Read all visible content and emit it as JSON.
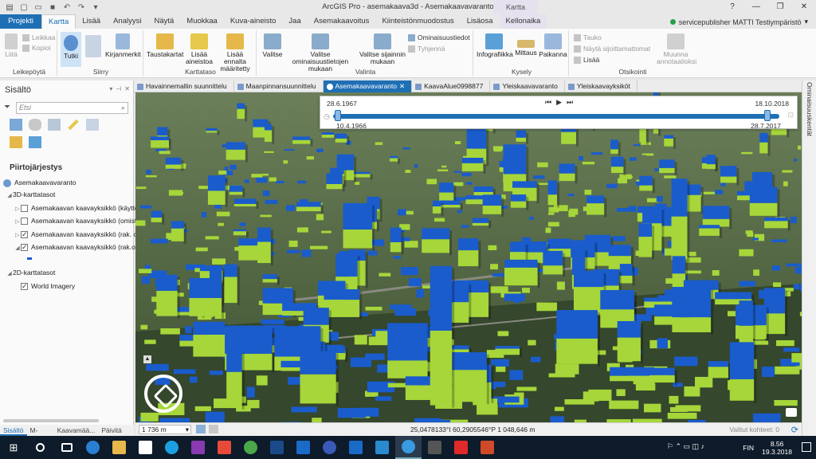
{
  "app": {
    "title": "ArcGIS Pro - asemakaava3d - Asemakaavavaranto",
    "context_header": "Kartta",
    "user": "servicepublisher MATTI Testiympäristö"
  },
  "ribbon_tabs": [
    "Projekti",
    "Kartta",
    "Lisää",
    "Analyysi",
    "Näytä",
    "Muokkaa",
    "Kuva-aineisto",
    "Jaa",
    "Asemakaavoitus",
    "Kiinteistönmuodostus",
    "Lisäosa",
    "Kellonaika"
  ],
  "ribbon": {
    "leikepoyta": {
      "label": "Leikepöytä",
      "liita": "Liitä",
      "leikkaa": "Leikkaa",
      "kopioi": "Kopioi"
    },
    "siirry": {
      "label": "Siirry",
      "tutki": "Tutki",
      "kirjanmerkit": "Kirjanmerkit"
    },
    "karttataso": {
      "label": "Karttataso",
      "taustakartat": "Taustakartat",
      "lisaa_aineistoa": "Lisää aineistoa",
      "lisaa_ennalta": "Lisää ennalta määritetty"
    },
    "valinta": {
      "label": "Valinta",
      "valitse": "Valitse",
      "valitse_ominaisuus": "Valitse ominaisuustietojen mukaan",
      "valitse_sijainti": "Valitse sijainnin mukaan",
      "ominaisuustiedot": "Ominaisuustiedot",
      "tyhjenna": "Tyhjennä"
    },
    "kysely": {
      "label": "Kysely",
      "infografiikka": "Infografiikka",
      "mittaus": "Mittaus",
      "paikanna": "Paikanna"
    },
    "otsikointi": {
      "label": "Otsikointi",
      "tauko": "Tauko",
      "nayta": "Näytä sijoittamattomat",
      "lisaa": "Lisää",
      "muunna": "Muunna annotaatioksi"
    }
  },
  "contents": {
    "title": "Sisältö",
    "search_placeholder": "Etsi",
    "draw_order": "Piirtojärjestys",
    "map_name": "Asemakaavavaranto",
    "group_3d": "3D-karttatasot",
    "layers_3d": [
      {
        "name": "Asemakaavan kaavayksikkö (käyttöt",
        "checked": false
      },
      {
        "name": "Asemakaavan kaavayksikkö (omista",
        "checked": false
      },
      {
        "name": "Asemakaavan kaavayksikkö (rak. oik",
        "checked": true
      },
      {
        "name": "Asemakaavan kaavayksikkö (rak.oik.",
        "checked": true
      }
    ],
    "group_2d": "2D-karttatasot",
    "layers_2d": [
      {
        "name": "World Imagery",
        "checked": true
      }
    ]
  },
  "bottom_tabs": [
    "Sisältö",
    "M-Files",
    "Kaavamää...",
    "Päivitä k..."
  ],
  "view_tabs": [
    "Havainnemallin suunnittelu",
    "Maanpinnansuunnittelu",
    "Asemakaavavaranto",
    "KaavaAlue0998877",
    "Yleiskaavavaranto",
    "Yleiskaavayksiköt"
  ],
  "active_view": "Asemakaavavaranto",
  "right_pane": "Ominaisuuskentät",
  "time_slider": {
    "start": "28.6.1967",
    "end": "18.10.2018",
    "current_start": "10.4.1966",
    "current_end": "28.7.2017",
    "start_fraction": 0.01,
    "end_fraction": 0.97
  },
  "status": {
    "scale": "1 736 m",
    "coords": "25,0478133°I 60,2905546°P  1 048,646 m",
    "selected": "Valitut kohteet: 0"
  },
  "taskbar": {
    "lang": "FIN",
    "time": "8.56",
    "date": "19.3.2018"
  },
  "colors": {
    "accent": "#1f6fb5",
    "building_blue": "#1a5ccc",
    "building_green": "#a6d63a"
  }
}
